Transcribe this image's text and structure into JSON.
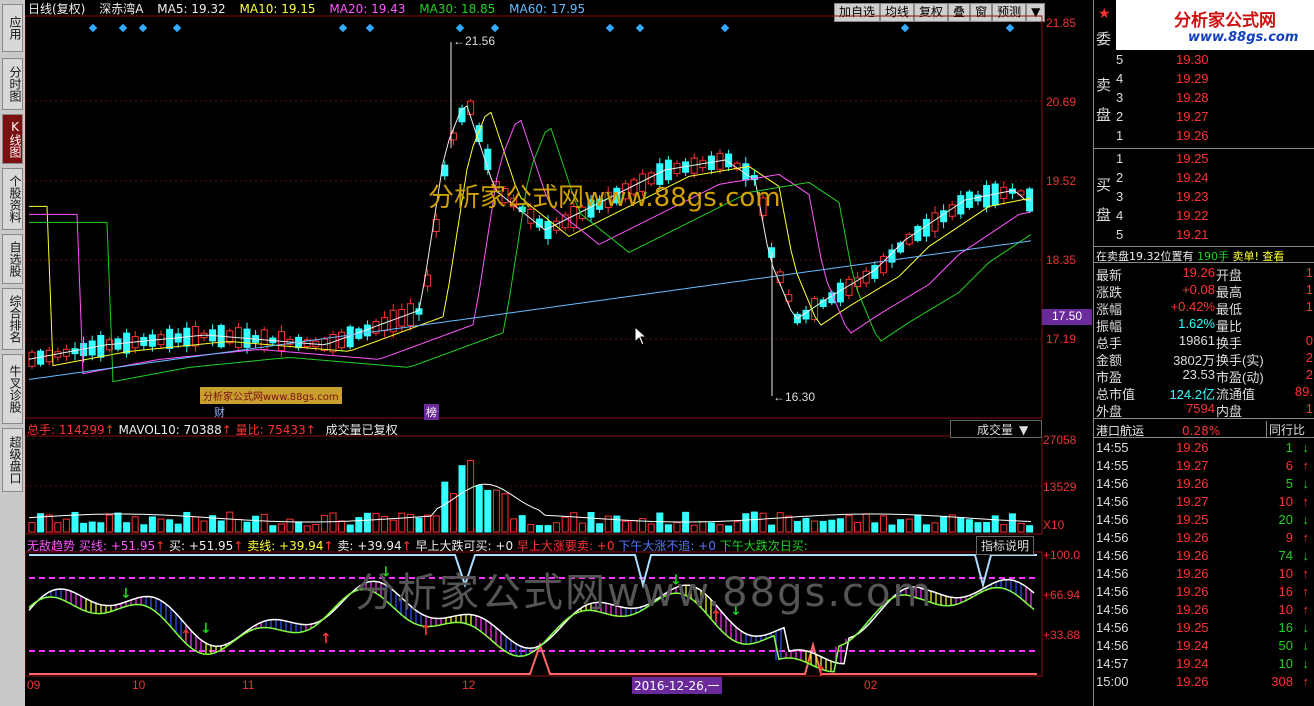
{
  "left_tabs": [
    "应用",
    "分时图",
    "K线图",
    "个股资料",
    "自选股",
    "综合排名",
    "牛叉诊股",
    "超级盘口"
  ],
  "header": {
    "period": "日线(复权)",
    "stock": "深赤湾A",
    "ma5": "MA5: 19.32",
    "ma10": "MA10: 19.15",
    "ma20": "MA20: 19.43",
    "ma30": "MA30: 18.85",
    "ma60": "MA60: 17.95",
    "buttons": [
      "加自选",
      "均线",
      "复权",
      "叠",
      "窗",
      "预测"
    ]
  },
  "price_axis": [
    "21.85",
    "20.69",
    "19.52",
    "18.35",
    "17.19"
  ],
  "price_marker": "17.50",
  "annotations": {
    "high": "21.56",
    "low": "16.30",
    "cai": "财",
    "bang": "榜"
  },
  "watermark_main": "分析家公式网www.88gs.com",
  "watermark_small": "分析家公式网www.88gs.com",
  "volume_header": {
    "total": "总手: 114299",
    "mavol": "MAVOL10: 70388",
    "ratio": "量比: 75433",
    "note": "成交量已复权",
    "dropdown": "成交量"
  },
  "volume_axis": [
    "27058",
    "13529",
    "X10"
  ],
  "indicator_header": {
    "name": "无敌趋势",
    "buy_line": "买线: +51.95",
    "buy": "买: +51.95",
    "sell_line": "卖线: +39.94",
    "sell": "卖: +39.94",
    "t1": "早上大跌可买: +0",
    "t2": "早上大涨要卖: +0",
    "t3": "下午大涨不追: +0",
    "t4": "下午大跌次日买:",
    "help": "指标说明"
  },
  "indicator_axis": [
    "+100.0",
    "+66.94",
    "+33.88"
  ],
  "indicator_watermark": "分析家公式网www.88gs.com",
  "date_axis": [
    "09",
    "10",
    "11",
    "12",
    "2016-12-26,一",
    "02"
  ],
  "logo": {
    "text": "分析家公式网",
    "url": "www.88gs.com"
  },
  "order_book": {
    "wei_label": "委",
    "sell_label": "卖盘",
    "buy_label": "买盘",
    "sells": [
      {
        "level": "5",
        "price": "19.30"
      },
      {
        "level": "4",
        "price": "19.29"
      },
      {
        "level": "3",
        "price": "19.28"
      },
      {
        "level": "2",
        "price": "19.27"
      },
      {
        "level": "1",
        "price": "19.26"
      }
    ],
    "buys": [
      {
        "level": "1",
        "price": "19.25"
      },
      {
        "level": "2",
        "price": "19.24"
      },
      {
        "level": "3",
        "price": "19.23"
      },
      {
        "level": "4",
        "price": "19.22"
      },
      {
        "level": "5",
        "price": "19.21"
      }
    ],
    "notice_a": "在卖盘19.32位置有",
    "notice_b": "190手",
    "notice_c": "卖单! 查看"
  },
  "stats": [
    {
      "k": "最新",
      "v": "19.26",
      "k2": "开盘",
      "v2": "1"
    },
    {
      "k": "涨跌",
      "v": "+0.08",
      "k2": "最高",
      "v2": "1"
    },
    {
      "k": "涨幅",
      "v": "+0.42%",
      "k2": "最低",
      "v2": "1"
    },
    {
      "k": "振幅",
      "v": "1.62%",
      "k2": "量比",
      "v2": ""
    },
    {
      "k": "总手",
      "v": "19861",
      "k2": "换手",
      "v2": "0"
    },
    {
      "k": "金额",
      "v": "3802万",
      "k2": "换手(实)",
      "v2": "2"
    },
    {
      "k": "市盈",
      "v": "23.53",
      "k2": "市盈(动)",
      "v2": "2"
    },
    {
      "k": "总市值",
      "v": "124.2亿",
      "k2": "流通值",
      "v2": "89."
    },
    {
      "k": "外盘",
      "v": "7594",
      "k2": "内盘",
      "v2": "1"
    }
  ],
  "sector": {
    "name": "港口航运",
    "pct": "0.28%",
    "peer": "同行比"
  },
  "ticks": [
    {
      "t": "14:55",
      "p": "19.26",
      "v": "1",
      "d": "down"
    },
    {
      "t": "14:55",
      "p": "19.27",
      "v": "6",
      "d": "up"
    },
    {
      "t": "14:56",
      "p": "19.26",
      "v": "5",
      "d": "down"
    },
    {
      "t": "14:56",
      "p": "19.27",
      "v": "10",
      "d": "up"
    },
    {
      "t": "14:56",
      "p": "19.25",
      "v": "20",
      "d": "down"
    },
    {
      "t": "14:56",
      "p": "19.26",
      "v": "9",
      "d": "up"
    },
    {
      "t": "14:56",
      "p": "19.26",
      "v": "74",
      "d": "down"
    },
    {
      "t": "14:56",
      "p": "19.26",
      "v": "10",
      "d": "up"
    },
    {
      "t": "14:56",
      "p": "19.26",
      "v": "16",
      "d": "up"
    },
    {
      "t": "14:56",
      "p": "19.26",
      "v": "10",
      "d": "up"
    },
    {
      "t": "14:56",
      "p": "19.25",
      "v": "16",
      "d": "down"
    },
    {
      "t": "14:56",
      "p": "19.24",
      "v": "50",
      "d": "down"
    },
    {
      "t": "14:57",
      "p": "19.24",
      "v": "10",
      "d": "down"
    },
    {
      "t": "15:00",
      "p": "19.26",
      "v": "308",
      "d": "up"
    }
  ],
  "colors": {
    "up": "#ff3333",
    "down": "#20d020",
    "cyan": "#33ffff",
    "bg": "#000000"
  }
}
